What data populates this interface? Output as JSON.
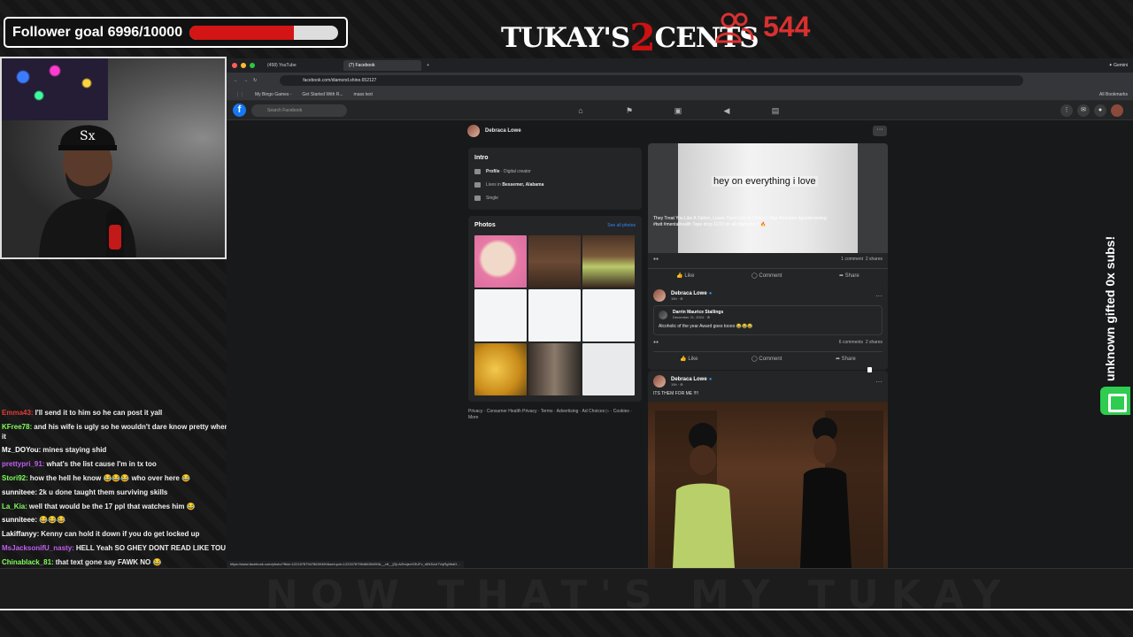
{
  "overlay": {
    "follower_goal": "Follower goal 6996/10000",
    "follower_progress": 0.6996,
    "logo_left": "TUKAY'S",
    "logo_mid": "2",
    "logo_right": "CENTS",
    "viewer_count": "544",
    "side_text": "unknown gifted 0x subs!",
    "banner_text": "NOW THAT'S MY TUKAY"
  },
  "chat": [
    {
      "user": "Emma43:",
      "color": "#e33b3b",
      "text": "I'll send it to him so he can post it yall"
    },
    {
      "user": "KFree78:",
      "color": "#7fff5a",
      "text": "and his wife is ugly so he wouldn't dare know pretty when he see it"
    },
    {
      "user": "Mz_DOYou:",
      "color": "#ffffff",
      "text": "mines staying shid"
    },
    {
      "user": "prettypri_91:",
      "color": "#c05ef0",
      "text": "what's the list cause I'm in tx too"
    },
    {
      "user": "Stori92:",
      "color": "#7fff5a",
      "text": "how the hell he know 😂😂😂 who over here 😂"
    },
    {
      "user": "sunniteee:",
      "color": "#ffffff",
      "text": "2k u done taught them surviving skills"
    },
    {
      "user": "La_Kia:",
      "color": "#7fff5a",
      "text": "well that would be the 17 ppl that watches him 😂"
    },
    {
      "user": "sunniteee:",
      "color": "#ffffff",
      "text": "😂😂😂"
    },
    {
      "user": "Lakiffanyy:",
      "color": "#ffffff",
      "text": "Kenny can hold it down if you do get locked up"
    },
    {
      "user": "MsJacksonifU_nasty:",
      "color": "#c05ef0",
      "text": "HELL Yeah SO GHEY DONT READ LIKE TOU 😂😂😂"
    },
    {
      "user": "Chinablack_81:",
      "color": "#7fff5a",
      "text": "that text gone say FAWK NO 😂"
    }
  ],
  "browser": {
    "tabs": [
      "(458) YouTube",
      "(7) Facebook"
    ],
    "gemini": "✦ Gemini",
    "url": "facebook.com/diamond.shine.652127",
    "bookmarks": [
      "My Bingo Games -",
      "Get Started With R...",
      "mass text"
    ],
    "all_bookmarks": "All Bookmarks",
    "status_url": "https://www.facebook.com/photo/?fbid=122157879478630490&set=pcb.122157879548630490&__cft__[0]=AZbnjevO3UFv_r6N3Uxi7VqRg9bdO..."
  },
  "facebook": {
    "search_placeholder": "Search Facebook",
    "profile_name": "Debraca Lowe",
    "intro": {
      "title": "Intro",
      "profile_label": "Profile",
      "profile_value": "· Digital creator",
      "lives_label": "Lives in",
      "lives_value": "Bessemer, Alabama",
      "relationship": "Single"
    },
    "photos": {
      "title": "Photos",
      "see_all": "See all photos"
    },
    "footer": "Privacy · Consumer Health Privacy · Terms · Advertising · Ad Choices ▷ · Cookies · More",
    "post1": {
      "caption_overlay": "hey on everything i love",
      "overlay_text": "They Treat You Like A Option, Leave Them Like A Choice ! #fyp #houston #goodmorning #twit #mentalhealth Tape drop 11/23 on all platforms !! 🔥",
      "comments": "1 comment",
      "shares": "2 shares"
    },
    "post2": {
      "author": "Debraca Lowe",
      "time": "19h · ⊕",
      "shared_author": "Darrin Maurice Stallings",
      "shared_date": "December 21, 2024 · ⊕",
      "shared_text": "Alcoholic of the year Award goes toooo 😂😂😂",
      "comments": "6 comments",
      "shares": "2 shares"
    },
    "post3": {
      "author": "Debraca Lowe",
      "time": "19h · ⊕",
      "text": "ITS THEM FOR ME !!!!"
    },
    "actions": {
      "like": "Like",
      "comment": "Comment",
      "share": "Share"
    }
  }
}
